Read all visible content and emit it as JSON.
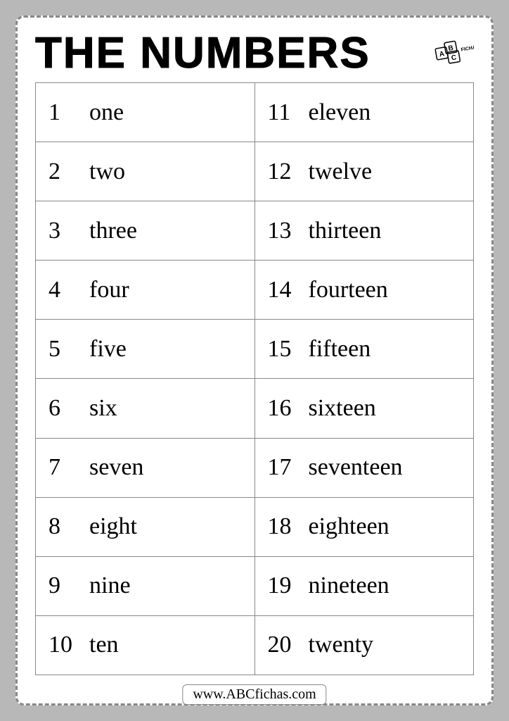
{
  "title": "THE NUMBERS",
  "logo_text": "ABC FICHAS",
  "footer": "www.ABCfichas.com",
  "numbers": {
    "left": [
      {
        "n": "1",
        "w": "one"
      },
      {
        "n": "2",
        "w": "two"
      },
      {
        "n": "3",
        "w": "three"
      },
      {
        "n": "4",
        "w": "four"
      },
      {
        "n": "5",
        "w": "five"
      },
      {
        "n": "6",
        "w": "six"
      },
      {
        "n": "7",
        "w": "seven"
      },
      {
        "n": "8",
        "w": "eight"
      },
      {
        "n": "9",
        "w": "nine"
      },
      {
        "n": "10",
        "w": "ten"
      }
    ],
    "right": [
      {
        "n": "11",
        "w": "eleven"
      },
      {
        "n": "12",
        "w": "twelve"
      },
      {
        "n": "13",
        "w": "thirteen"
      },
      {
        "n": "14",
        "w": "fourteen"
      },
      {
        "n": "15",
        "w": "fifteen"
      },
      {
        "n": "16",
        "w": "sixteen"
      },
      {
        "n": "17",
        "w": "seventeen"
      },
      {
        "n": "18",
        "w": "eighteen"
      },
      {
        "n": "19",
        "w": "nineteen"
      },
      {
        "n": "20",
        "w": "twenty"
      }
    ]
  }
}
